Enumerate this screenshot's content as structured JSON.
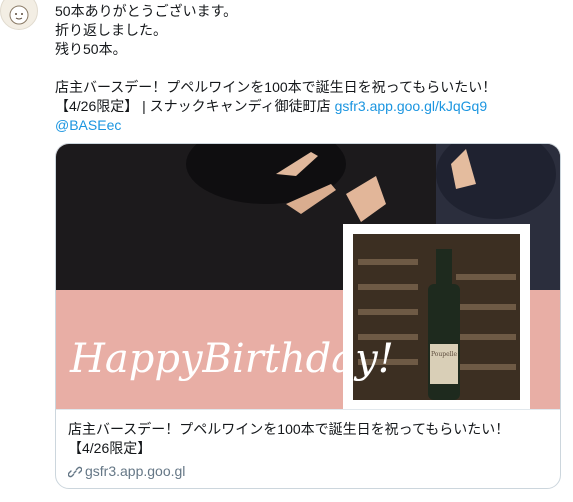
{
  "tweet": {
    "lines": [
      "50本ありがとうございます。",
      "折り返しました。",
      "残り50本。"
    ],
    "body_text": "店主バースデー！プペルワインを100本で誕生日を祝ってもらいたい！",
    "body_line2": "【4/26限定】 | スナックキャンディ御徒町店 ",
    "link_url": "gsfr3.app.goo.gl/kJqGq9",
    "mention": "@BASEec"
  },
  "card": {
    "title_line1": "店主バースデー！プペルワインを100本で誕生日を祝ってもらいたい！",
    "title_line2": "【4/26限定】",
    "domain": "gsfr3.app.goo.gl",
    "banner_text": "HappyBirthday!",
    "bottle_label": "Poupelle"
  },
  "colors": {
    "link": "#1b95e0",
    "banner_pink": "#e8aea5",
    "border": "#ccd6dd",
    "secondary_text": "#657786"
  },
  "icons": {
    "avatar": "avatar-illustration",
    "domain_link": "link-icon"
  }
}
